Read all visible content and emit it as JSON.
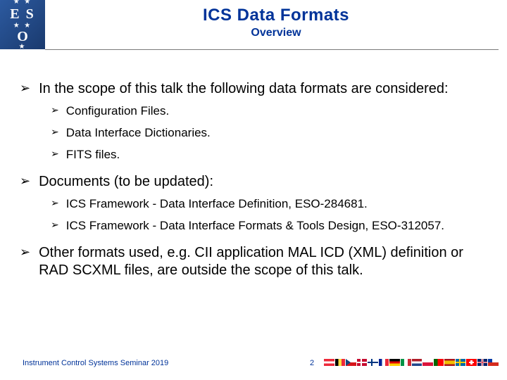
{
  "logo": {
    "line1": "E S",
    "line2": "O"
  },
  "header": {
    "title": "ICS Data Formats",
    "subtitle": "Overview"
  },
  "body": [
    {
      "text": "In the scope of this talk the following data formats are considered:",
      "children": [
        "Configuration Files.",
        "Data Interface Dictionaries.",
        "FITS files."
      ]
    },
    {
      "text": "Documents (to be updated):",
      "children": [
        "ICS Framework - Data Interface Definition, ESO-284681.",
        "ICS Framework - Data Interface Formats & Tools Design, ESO-312057."
      ]
    },
    {
      "text": "Other formats used, e.g. CII application MAL ICD (XML) definition or RAD SCXML files, are outside the scope of this talk.",
      "children": []
    }
  ],
  "footer": {
    "left": "Instrument Control Systems Seminar 2019",
    "page": "2",
    "flags": [
      "at",
      "be",
      "cz",
      "dk",
      "fi",
      "fr",
      "de",
      "it",
      "nl",
      "pl",
      "pt",
      "es",
      "se",
      "ch",
      "uk",
      "cl"
    ]
  }
}
